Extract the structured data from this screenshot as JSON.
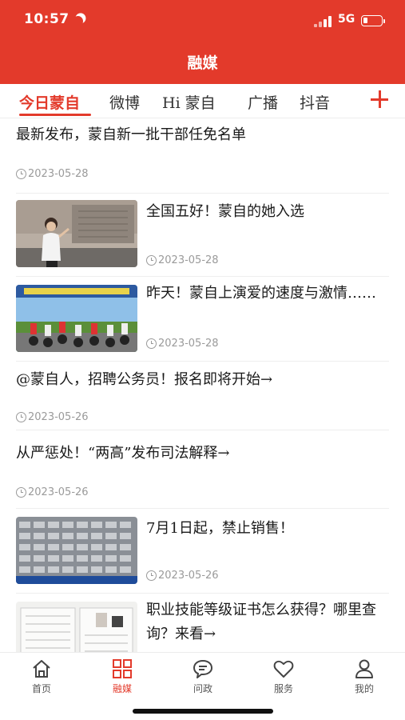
{
  "status_bar": {
    "time": "10:57",
    "network": "5G"
  },
  "header": {
    "title": "融媒"
  },
  "tabs": [
    {
      "label": "今日蒙自",
      "active": true
    },
    {
      "label": "微博"
    },
    {
      "label": "Hi 蒙自"
    },
    {
      "label": "广播"
    },
    {
      "label": "抖音"
    }
  ],
  "news": [
    {
      "title": "最新发布，蒙自新一批干部任免名单",
      "date": "2023-05-28"
    },
    {
      "title": "全国五好！蒙自的她入选",
      "date": "2023-05-28"
    },
    {
      "title": "昨天！蒙自上演爱的速度与激情……",
      "date": "2023-05-28"
    },
    {
      "title": "@蒙自人，招聘公务员！报名即将开始→",
      "date": "2023-05-26"
    },
    {
      "title": "从严惩处！“两高”发布司法解释→",
      "date": "2023-05-26"
    },
    {
      "title": "7月1日起，禁止销售！",
      "date": "2023-05-26"
    },
    {
      "title": "职业技能等级证书怎么获得？哪里查询？来看→",
      "date": ""
    }
  ],
  "bottom_nav": [
    {
      "label": "首页",
      "icon": "home-icon"
    },
    {
      "label": "融媒",
      "icon": "grid-icon",
      "active": true
    },
    {
      "label": "问政",
      "icon": "chat-icon"
    },
    {
      "label": "服务",
      "icon": "heart-icon"
    },
    {
      "label": "我的",
      "icon": "person-icon"
    }
  ],
  "colors": {
    "accent": "#e33a2b",
    "text": "#1a1a1a",
    "muted": "#9a9a9a"
  }
}
